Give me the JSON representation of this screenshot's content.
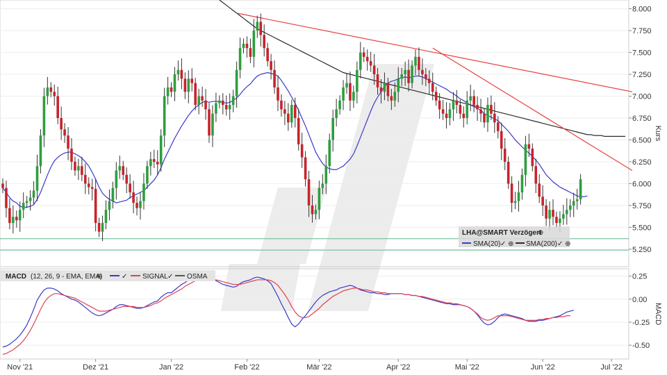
{
  "chart_data": [
    {
      "type": "candlestick",
      "ylabel": "Kurs",
      "ylim": [
        5.05,
        8.1
      ],
      "yticks": [
        "8.000",
        "7.750",
        "7.500",
        "7.250",
        "7.000",
        "6.750",
        "6.500",
        "6.250",
        "6.000",
        "5.750",
        "5.500",
        "5.250"
      ],
      "ytick_values": [
        8.0,
        7.75,
        7.5,
        7.25,
        7.0,
        6.75,
        6.5,
        6.25,
        6.0,
        5.75,
        5.5,
        5.25
      ],
      "xticks": [
        "Nov '21",
        "Dez '21",
        "Jan '22",
        "Feb '22",
        "Mär '22",
        "Apr '22",
        "Mai '22",
        "Jun '22",
        "Jul '22"
      ],
      "xtick_index": [
        5,
        27,
        49,
        71,
        92,
        115,
        135,
        157,
        177
      ],
      "legend": {
        "title": "LHA@SMART Verzögert",
        "items": [
          {
            "name": "SMA(20)",
            "color": "#3a3ac8"
          },
          {
            "name": "SMA(200)",
            "color": "#2b2b2b"
          }
        ]
      },
      "colors": {
        "up": "#2e9e3e",
        "down": "#c8232c",
        "sma20": "#3a3ac8",
        "sma200": "#2b2b2b",
        "trend": "#e8403f",
        "support": "#5ab98a"
      },
      "closes": [
        5.95,
        5.72,
        5.55,
        5.62,
        5.58,
        5.7,
        5.78,
        5.8,
        5.84,
        5.92,
        6.2,
        6.55,
        7.0,
        7.1,
        7.05,
        7.0,
        6.75,
        6.62,
        6.55,
        6.4,
        6.25,
        6.15,
        6.2,
        6.1,
        6.0,
        5.96,
        5.94,
        5.55,
        5.45,
        5.55,
        5.7,
        5.8,
        5.95,
        6.15,
        6.2,
        6.1,
        6.0,
        5.9,
        5.78,
        5.72,
        5.8,
        6.0,
        6.2,
        6.28,
        6.25,
        6.22,
        6.55,
        7.0,
        7.1,
        7.05,
        7.25,
        7.3,
        7.2,
        7.05,
        7.2,
        7.15,
        6.9,
        7.0,
        6.95,
        6.85,
        6.55,
        6.8,
        6.92,
        6.95,
        6.9,
        6.85,
        6.9,
        7.0,
        7.3,
        7.55,
        7.6,
        7.55,
        7.45,
        7.75,
        7.85,
        7.7,
        7.55,
        7.4,
        7.3,
        7.1,
        6.95,
        6.85,
        6.8,
        6.7,
        6.9,
        6.75,
        6.45,
        6.3,
        6.05,
        5.75,
        5.65,
        5.7,
        5.95,
        6.0,
        6.2,
        6.5,
        6.75,
        6.85,
        6.95,
        7.1,
        7.15,
        6.95,
        7.05,
        7.3,
        7.5,
        7.45,
        7.4,
        7.35,
        7.25,
        7.1,
        7.05,
        7.15,
        7.0,
        6.95,
        7.05,
        7.2,
        7.25,
        7.3,
        7.15,
        7.35,
        7.45,
        7.3,
        7.25,
        7.2,
        7.15,
        7.05,
        6.95,
        6.85,
        6.8,
        6.75,
        6.85,
        6.95,
        6.9,
        6.8,
        6.75,
        6.95,
        7.0,
        6.9,
        6.85,
        6.8,
        6.7,
        6.9,
        6.8,
        6.7,
        6.6,
        6.4,
        6.25,
        6.0,
        5.78,
        5.8,
        5.9,
        6.1,
        6.45,
        6.4,
        6.2,
        6.0,
        5.85,
        5.75,
        5.6,
        5.7,
        5.62,
        5.55,
        5.6,
        5.65,
        5.7,
        5.75,
        5.8,
        5.82,
        6.05
      ],
      "sma20": [
        5.95,
        5.9,
        5.84,
        5.8,
        5.78,
        5.74,
        5.73,
        5.73,
        5.74,
        5.76,
        5.82,
        5.9,
        6.0,
        6.1,
        6.19,
        6.26,
        6.3,
        6.33,
        6.35,
        6.36,
        6.36,
        6.34,
        6.32,
        6.29,
        6.25,
        6.2,
        6.13,
        6.05,
        5.96,
        5.89,
        5.85,
        5.82,
        5.8,
        5.78,
        5.79,
        5.8,
        5.81,
        5.84,
        5.86,
        5.88,
        5.9,
        5.92,
        5.96,
        6.0,
        6.04,
        6.1,
        6.18,
        6.28,
        6.36,
        6.44,
        6.52,
        6.59,
        6.66,
        6.72,
        6.78,
        6.83,
        6.87,
        6.9,
        6.93,
        6.94,
        6.93,
        6.94,
        6.94,
        6.94,
        6.93,
        6.92,
        6.93,
        6.95,
        6.98,
        7.02,
        7.07,
        7.11,
        7.14,
        7.19,
        7.23,
        7.25,
        7.26,
        7.27,
        7.26,
        7.25,
        7.23,
        7.18,
        7.12,
        7.06,
        6.99,
        6.92,
        6.84,
        6.75,
        6.66,
        6.56,
        6.46,
        6.36,
        6.29,
        6.23,
        6.19,
        6.17,
        6.16,
        6.16,
        6.18,
        6.2,
        6.24,
        6.28,
        6.34,
        6.43,
        6.53,
        6.63,
        6.73,
        6.83,
        6.92,
        6.99,
        7.05,
        7.11,
        7.15,
        7.17,
        7.18,
        7.2,
        7.21,
        7.22,
        7.21,
        7.22,
        7.23,
        7.23,
        7.22,
        7.2,
        7.18,
        7.16,
        7.14,
        7.12,
        7.1,
        7.08,
        7.05,
        7.03,
        7.0,
        6.97,
        6.95,
        6.92,
        6.9,
        6.88,
        6.86,
        6.84,
        6.8,
        6.78,
        6.76,
        6.74,
        6.72,
        6.68,
        6.64,
        6.6,
        6.55,
        6.5,
        6.46,
        6.42,
        6.38,
        6.35,
        6.31,
        6.27,
        6.22,
        6.16,
        6.1,
        6.06,
        6.02,
        5.99,
        5.96,
        5.94,
        5.92,
        5.9,
        5.88,
        5.86,
        5.85,
        5.85,
        5.86
      ],
      "sma200_start": 63,
      "sma200": [
        8.1,
        8.07,
        8.04,
        8.01,
        7.98,
        7.95,
        7.92,
        7.89,
        7.86,
        7.83,
        7.8,
        7.77,
        7.75,
        7.73,
        7.71,
        7.69,
        7.67,
        7.65,
        7.63,
        7.61,
        7.59,
        7.57,
        7.55,
        7.53,
        7.51,
        7.49,
        7.47,
        7.45,
        7.43,
        7.41,
        7.39,
        7.37,
        7.35,
        7.33,
        7.31,
        7.29,
        7.27,
        7.26,
        7.25,
        7.24,
        7.23,
        7.22,
        7.21,
        7.2,
        7.19,
        7.18,
        7.17,
        7.16,
        7.15,
        7.14,
        7.13,
        7.12,
        7.11,
        7.1,
        7.09,
        7.08,
        7.07,
        7.06,
        7.05,
        7.04,
        7.03,
        7.02,
        7.01,
        7.0,
        6.99,
        6.98,
        6.97,
        6.96,
        6.95,
        6.94,
        6.93,
        6.92,
        6.91,
        6.9,
        6.89,
        6.88,
        6.87,
        6.86,
        6.85,
        6.84,
        6.83,
        6.82,
        6.81,
        6.8,
        6.79,
        6.78,
        6.77,
        6.76,
        6.75,
        6.74,
        6.73,
        6.72,
        6.71,
        6.7,
        6.69,
        6.68,
        6.67,
        6.66,
        6.65,
        6.64,
        6.63,
        6.62,
        6.61,
        6.6,
        6.59,
        6.58,
        6.57,
        6.56,
        6.56,
        6.55,
        6.55,
        6.55,
        6.54,
        6.54,
        6.54,
        6.54,
        6.54,
        6.54,
        6.54
      ],
      "trendlines": [
        {
          "from": [
            68,
            7.95
          ],
          "to": [
            183,
            7.05
          ]
        },
        {
          "from": [
            125,
            7.55
          ],
          "to": [
            183,
            6.15
          ]
        }
      ],
      "support": [
        5.37,
        5.24
      ]
    },
    {
      "type": "line",
      "title": "MACD",
      "subtitle": "(12, 26, 9 - EMA, EMA)",
      "ylabel": "MACD",
      "ylim": [
        -0.65,
        0.33
      ],
      "yticks": [
        "0.25",
        "0.00",
        "-0.25",
        "-0.50"
      ],
      "ytick_values": [
        0.25,
        0.0,
        -0.25,
        -0.5
      ],
      "series": [
        {
          "name": "MACD",
          "color": "#3a3ac8",
          "values": [
            -0.52,
            -0.51,
            -0.49,
            -0.46,
            -0.43,
            -0.39,
            -0.34,
            -0.28,
            -0.2,
            -0.11,
            -0.01,
            0.05,
            0.1,
            0.12,
            0.12,
            0.11,
            0.09,
            0.06,
            0.04,
            0.02,
            0.0,
            -0.01,
            -0.03,
            -0.06,
            -0.09,
            -0.12,
            -0.15,
            -0.17,
            -0.18,
            -0.17,
            -0.15,
            -0.13,
            -0.11,
            -0.08,
            -0.06,
            -0.06,
            -0.07,
            -0.08,
            -0.09,
            -0.1,
            -0.1,
            -0.09,
            -0.07,
            -0.05,
            -0.03,
            -0.02,
            0.02,
            0.05,
            0.07,
            0.07,
            0.1,
            0.13,
            0.16,
            0.18,
            0.21,
            0.23,
            0.24,
            0.25,
            0.26,
            0.25,
            0.23,
            0.21,
            0.2,
            0.18,
            0.16,
            0.15,
            0.14,
            0.13,
            0.14,
            0.17,
            0.19,
            0.2,
            0.21,
            0.23,
            0.24,
            0.23,
            0.22,
            0.2,
            0.17,
            0.1,
            0.03,
            -0.05,
            -0.12,
            -0.2,
            -0.27,
            -0.3,
            -0.27,
            -0.22,
            -0.18,
            -0.13,
            -0.08,
            -0.03,
            0.01,
            0.04,
            0.06,
            0.08,
            0.09,
            0.1,
            0.12,
            0.13,
            0.14,
            0.15,
            0.14,
            0.12,
            0.1,
            0.09,
            0.08,
            0.07,
            0.07,
            0.06,
            0.06,
            0.05,
            0.05,
            0.06,
            0.06,
            0.06,
            0.06,
            0.05,
            0.05,
            0.04,
            0.04,
            0.03,
            0.02,
            0.01,
            0.0,
            -0.01,
            -0.02,
            -0.03,
            -0.04,
            -0.05,
            -0.05,
            -0.06,
            -0.06,
            -0.06,
            -0.07,
            -0.08,
            -0.1,
            -0.13,
            -0.17,
            -0.22,
            -0.26,
            -0.28,
            -0.27,
            -0.24,
            -0.2,
            -0.17,
            -0.16,
            -0.17,
            -0.18,
            -0.19,
            -0.2,
            -0.21,
            -0.23,
            -0.24,
            -0.24,
            -0.24,
            -0.23,
            -0.23,
            -0.22,
            -0.21,
            -0.2,
            -0.19,
            -0.18,
            -0.16,
            -0.14,
            -0.13,
            -0.12
          ]
        },
        {
          "name": "SIGNAL",
          "color": "#e04050",
          "values": [
            -0.6,
            -0.59,
            -0.57,
            -0.55,
            -0.52,
            -0.49,
            -0.45,
            -0.4,
            -0.34,
            -0.27,
            -0.19,
            -0.11,
            -0.04,
            0.01,
            0.04,
            0.06,
            0.06,
            0.05,
            0.04,
            0.03,
            0.02,
            0.01,
            -0.01,
            -0.03,
            -0.05,
            -0.07,
            -0.09,
            -0.11,
            -0.13,
            -0.13,
            -0.13,
            -0.12,
            -0.11,
            -0.1,
            -0.09,
            -0.08,
            -0.08,
            -0.08,
            -0.08,
            -0.09,
            -0.09,
            -0.09,
            -0.08,
            -0.07,
            -0.05,
            -0.04,
            -0.02,
            0.01,
            0.03,
            0.05,
            0.07,
            0.09,
            0.11,
            0.14,
            0.16,
            0.18,
            0.2,
            0.21,
            0.22,
            0.23,
            0.23,
            0.22,
            0.21,
            0.2,
            0.19,
            0.18,
            0.17,
            0.16,
            0.16,
            0.16,
            0.17,
            0.18,
            0.19,
            0.2,
            0.21,
            0.21,
            0.21,
            0.21,
            0.2,
            0.18,
            0.15,
            0.1,
            0.05,
            -0.01,
            -0.08,
            -0.14,
            -0.18,
            -0.2,
            -0.2,
            -0.19,
            -0.16,
            -0.13,
            -0.1,
            -0.06,
            -0.03,
            0.0,
            0.03,
            0.05,
            0.07,
            0.09,
            0.1,
            0.11,
            0.12,
            0.12,
            0.11,
            0.1,
            0.1,
            0.09,
            0.08,
            0.08,
            0.07,
            0.07,
            0.06,
            0.06,
            0.06,
            0.06,
            0.06,
            0.05,
            0.05,
            0.04,
            0.04,
            0.03,
            0.03,
            0.02,
            0.01,
            0.0,
            -0.01,
            -0.02,
            -0.03,
            -0.04,
            -0.04,
            -0.05,
            -0.05,
            -0.06,
            -0.07,
            -0.08,
            -0.1,
            -0.13,
            -0.16,
            -0.2,
            -0.22,
            -0.23,
            -0.22,
            -0.2,
            -0.18,
            -0.18,
            -0.18,
            -0.18,
            -0.19,
            -0.2,
            -0.21,
            -0.22,
            -0.23,
            -0.23,
            -0.23,
            -0.23,
            -0.22,
            -0.22,
            -0.21,
            -0.21,
            -0.2,
            -0.2,
            -0.19,
            -0.19,
            -0.18,
            -0.18
          ]
        }
      ],
      "legend": {
        "items": [
          {
            "name": "SIGNAL",
            "color": "#e04050"
          },
          {
            "name": "OSMA",
            "color": "#555555"
          }
        ]
      }
    }
  ]
}
